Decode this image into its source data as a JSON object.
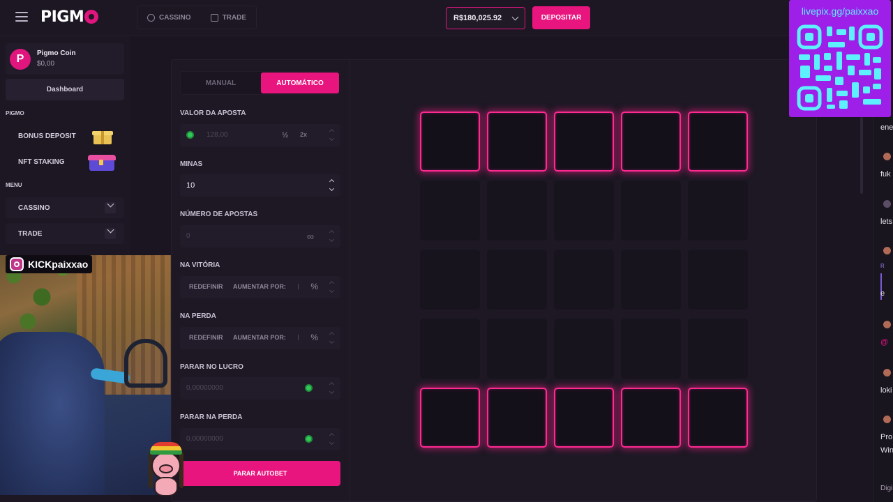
{
  "header": {
    "brand": "PIGM",
    "nav": [
      {
        "label": "CASSINO",
        "icon": "casino-icon"
      },
      {
        "label": "TRADE",
        "icon": "trade-icon"
      }
    ],
    "balance": "R$180,025.92",
    "deposit_label": "DEPOSITAR"
  },
  "sidebar": {
    "coin": {
      "name": "Pigmo Coin",
      "balance": "$0,00",
      "logo_letter": "P"
    },
    "dashboard_label": "Dashboard",
    "section_pigmo": "PIGMO",
    "promo_items": [
      {
        "label": "BONUS DEPOSIT",
        "icon": "gift-icon"
      },
      {
        "label": "NFT STAKING",
        "icon": "treasure-chest-icon"
      }
    ],
    "section_menu": "MENU",
    "menu_items": [
      {
        "label": "CASSINO"
      },
      {
        "label": "TRADE"
      }
    ]
  },
  "stream": {
    "kick_handle": "KICKpaixxao",
    "qr_url_text": "livepix.gg/paixxao"
  },
  "game": {
    "mode_tabs": [
      {
        "label": "MANUAL",
        "active": false
      },
      {
        "label": "AUTOMÁTICO",
        "active": true
      }
    ],
    "bet_amount": {
      "label": "VALOR DA APOSTA",
      "placeholder": "128,00",
      "half_label": "½",
      "double_label": "2x"
    },
    "mines": {
      "label": "MINAS",
      "value": "10"
    },
    "num_bets": {
      "label": "NÚMERO DE APOSTAS",
      "placeholder": "0",
      "infinite_symbol": "∞"
    },
    "on_win": {
      "label": "NA VITÓRIA",
      "reset_label": "REDEFINIR",
      "increase_label": "AUMENTAR POR:",
      "pct_symbol": "%"
    },
    "on_loss": {
      "label": "NA PERDA",
      "reset_label": "REDEFINIR",
      "increase_label": "AUMENTAR POR:",
      "pct_symbol": "%"
    },
    "stop_profit": {
      "label": "PARAR NO LUCRO",
      "placeholder": "0,00000000"
    },
    "stop_loss": {
      "label": "PARAR NA PERDA",
      "placeholder": "0,00000000"
    },
    "stop_autobet_label": "PARAR AUTOBET",
    "grid": {
      "rows": 5,
      "cols": 5,
      "selected_tiles": [
        0,
        1,
        2,
        3,
        4,
        20,
        21,
        22,
        23,
        24
      ]
    }
  },
  "chat": {
    "messages": [
      "ene",
      "fuk",
      "lets",
      "R",
      "e",
      "@",
      "loki",
      "Pro",
      "Win",
      "Digi"
    ]
  },
  "colors": {
    "accent": "#e8157f",
    "tile_glow": "#ff2a92",
    "qr_bg": "#9d1fe8",
    "qr_fg": "#5df0ff",
    "coin_green": "#34c759"
  }
}
